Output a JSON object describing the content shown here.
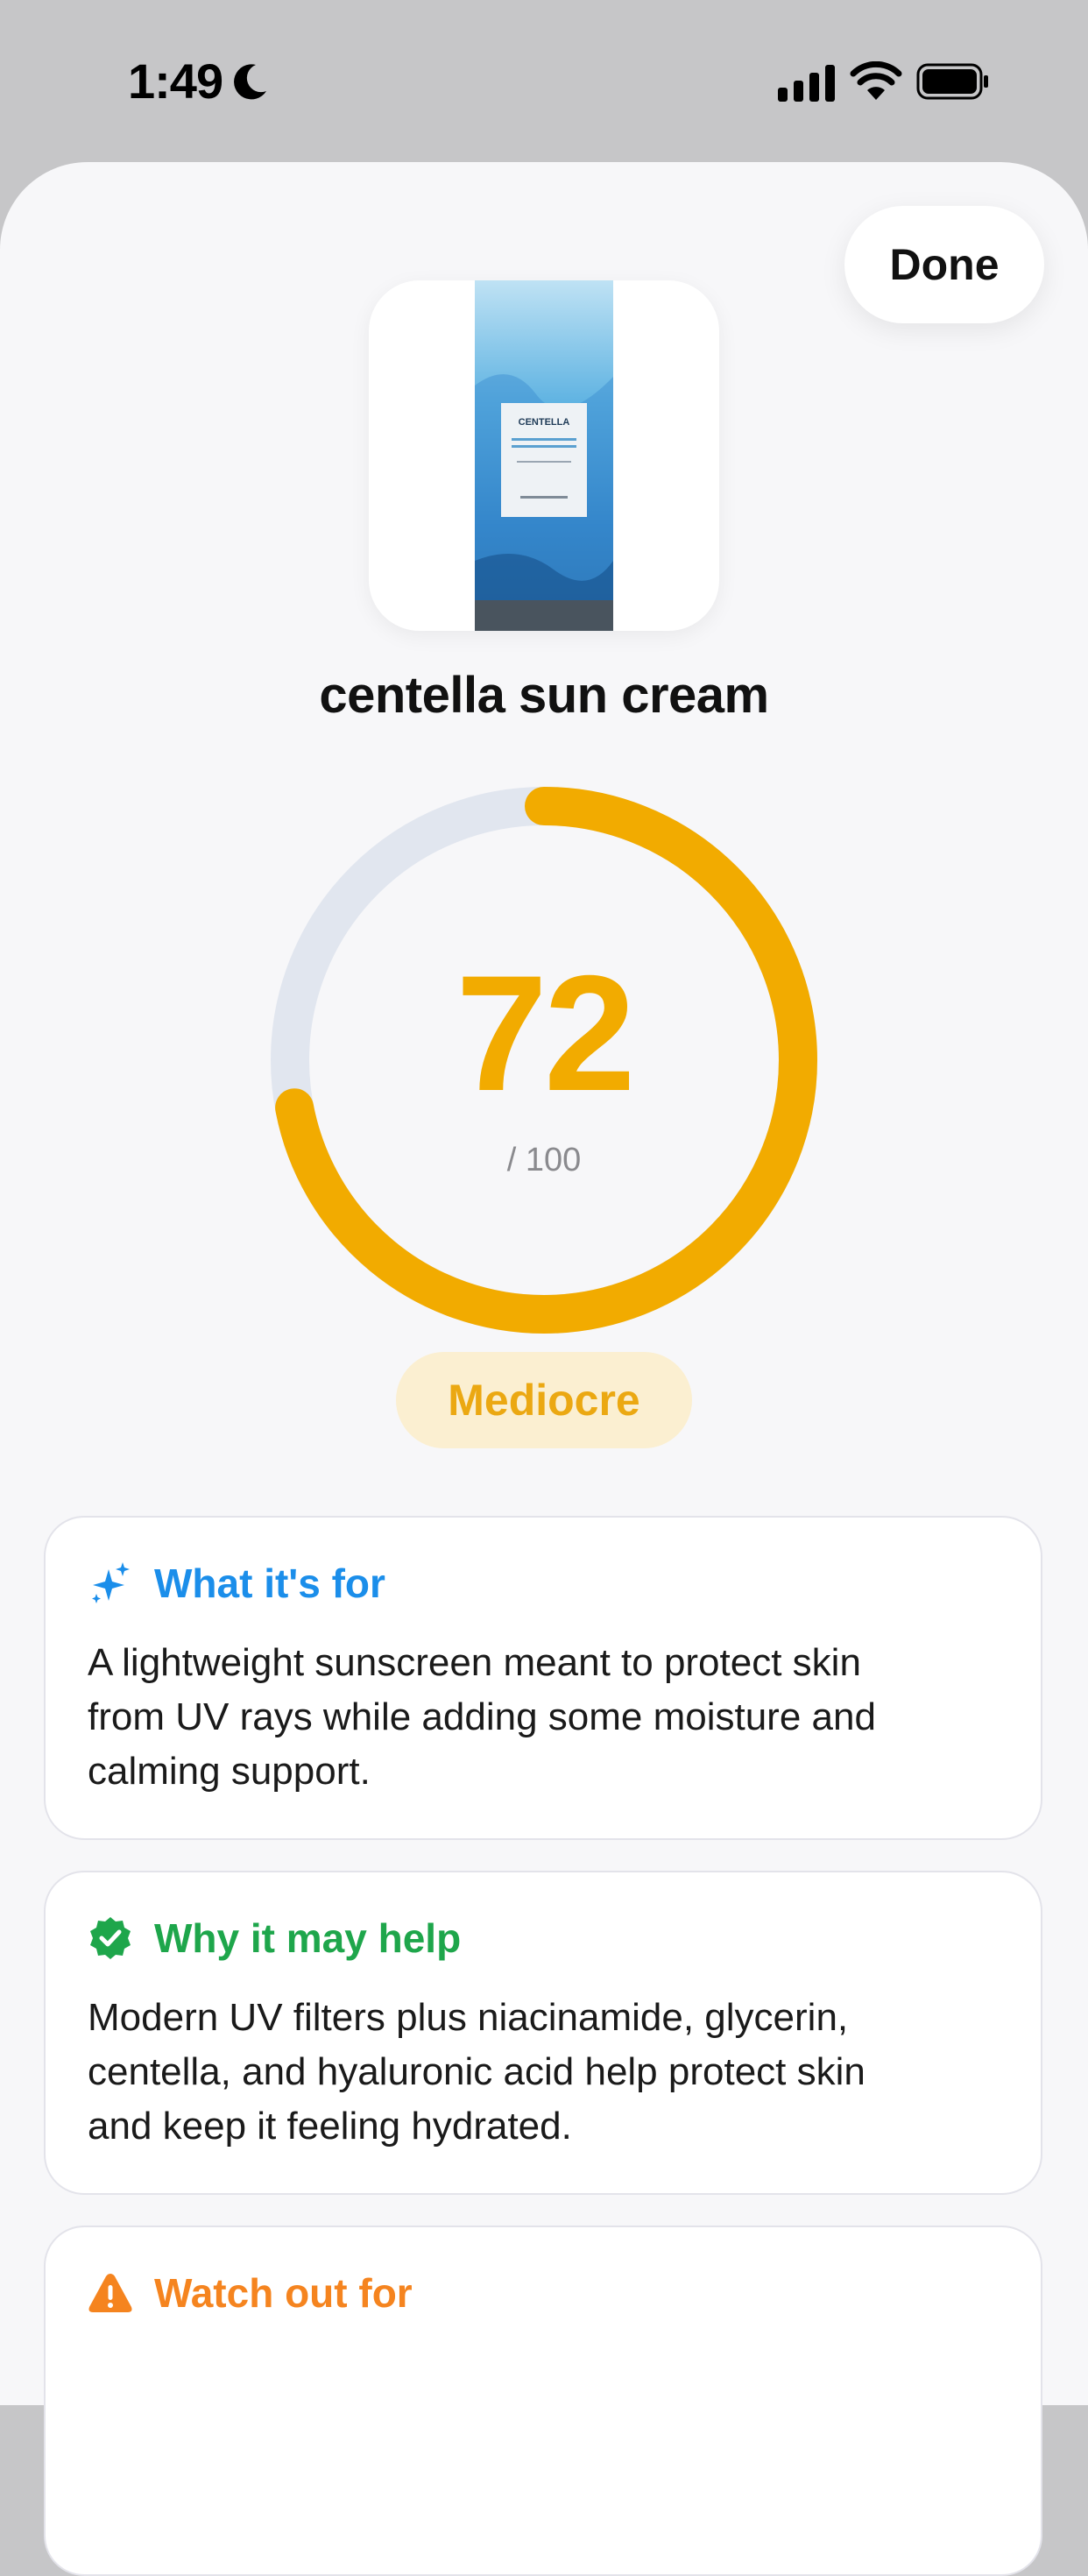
{
  "status_bar": {
    "time": "1:49",
    "icons": [
      "moon-icon",
      "cellular-signal-icon",
      "wifi-icon",
      "battery-icon"
    ]
  },
  "sheet": {
    "done_label": "Done",
    "product": {
      "name": "centella sun cream",
      "image_label": "CENTELLA"
    },
    "score": {
      "value": "72",
      "max_label": "/ 100",
      "fraction": 0.72,
      "rating": "Mediocre",
      "color": "#f2ab00",
      "track_color": "#e1e6ef"
    },
    "cards": [
      {
        "icon": "sparkles-icon",
        "title": "What it's for",
        "accent": "#1b8eea",
        "lines": [
          "A lightweight sunscreen meant to protect skin",
          "from UV rays while adding some moisture and",
          "calming support."
        ]
      },
      {
        "icon": "check-badge-icon",
        "title": "Why it may help",
        "accent": "#1ea64b",
        "lines": [
          "Modern UV filters plus niacinamide, glycerin,",
          "centella, and hyaluronic acid help protect skin",
          "and keep it feeling hydrated."
        ]
      },
      {
        "icon": "warning-icon",
        "title": "Watch out for",
        "accent": "#f5841f",
        "lines": []
      }
    ]
  }
}
